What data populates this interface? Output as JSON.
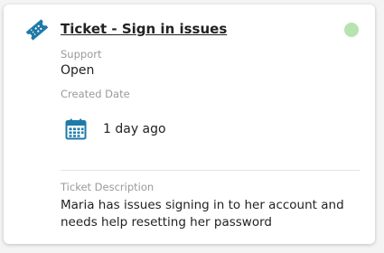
{
  "ticket": {
    "title": "Ticket - Sign in issues",
    "icon": "ticket-icon",
    "status_color": "#b7e3b0",
    "category_label": "Support",
    "status_value": "Open",
    "created_label": "Created Date",
    "created_value": "1 day ago",
    "created_icon": "calendar-icon",
    "description_label": "Ticket Description",
    "description": "Maria has issues signing in to her account and needs help resetting her password"
  },
  "colors": {
    "accent": "#1f7aa8",
    "card_background": "#ffffff",
    "page_background": "#f4f4f4"
  }
}
